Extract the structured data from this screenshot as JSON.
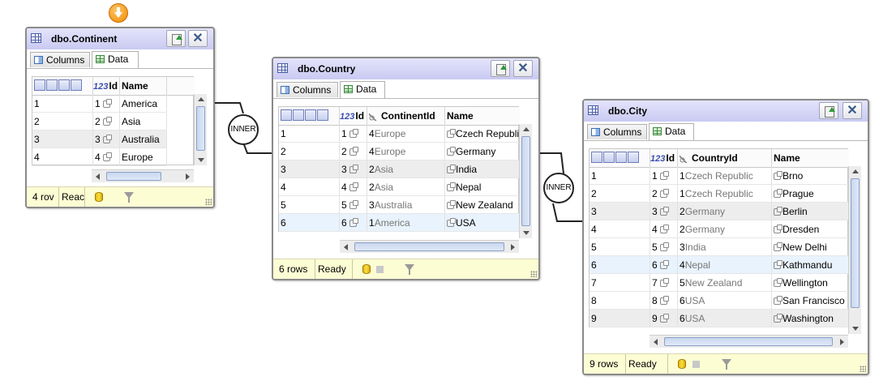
{
  "continent": {
    "title": "dbo.Continent",
    "tabs": [
      "Columns",
      "Data"
    ],
    "columns": [
      "Id",
      "Name"
    ],
    "rows": [
      {
        "num": "1",
        "id": "1",
        "name": "America"
      },
      {
        "num": "2",
        "id": "2",
        "name": "Asia"
      },
      {
        "num": "3",
        "id": "3",
        "name": "Australia"
      },
      {
        "num": "4",
        "id": "4",
        "name": "Europe"
      }
    ],
    "status": {
      "rows": "4 rov",
      "state": "Reac"
    }
  },
  "country": {
    "title": "dbo.Country",
    "tabs": [
      "Columns",
      "Data"
    ],
    "columns": [
      "Id",
      "ContinentId",
      "Name"
    ],
    "rows": [
      {
        "num": "1",
        "id": "1",
        "fk_id": "4",
        "fk_name": "Europe",
        "name": "Czech Republic"
      },
      {
        "num": "2",
        "id": "2",
        "fk_id": "4",
        "fk_name": "Europe",
        "name": "Germany"
      },
      {
        "num": "3",
        "id": "3",
        "fk_id": "2",
        "fk_name": "Asia",
        "name": "India"
      },
      {
        "num": "4",
        "id": "4",
        "fk_id": "2",
        "fk_name": "Asia",
        "name": "Nepal"
      },
      {
        "num": "5",
        "id": "5",
        "fk_id": "3",
        "fk_name": "Australia",
        "name": "New Zealand"
      },
      {
        "num": "6",
        "id": "6",
        "fk_id": "1",
        "fk_name": "America",
        "name": "USA"
      }
    ],
    "status": {
      "rows": "6 rows",
      "state": "Ready"
    }
  },
  "city": {
    "title": "dbo.City",
    "tabs": [
      "Columns",
      "Data"
    ],
    "columns": [
      "Id",
      "CountryId",
      "Name"
    ],
    "rows": [
      {
        "num": "1",
        "id": "1",
        "fk_id": "1",
        "fk_name": "Czech Republic",
        "name": "Brno"
      },
      {
        "num": "2",
        "id": "2",
        "fk_id": "1",
        "fk_name": "Czech Republic",
        "name": "Prague"
      },
      {
        "num": "3",
        "id": "3",
        "fk_id": "2",
        "fk_name": "Germany",
        "name": "Berlin"
      },
      {
        "num": "4",
        "id": "4",
        "fk_id": "2",
        "fk_name": "Germany",
        "name": "Dresden"
      },
      {
        "num": "5",
        "id": "5",
        "fk_id": "3",
        "fk_name": "India",
        "name": "New Delhi"
      },
      {
        "num": "6",
        "id": "6",
        "fk_id": "4",
        "fk_name": "Nepal",
        "name": "Kathmandu"
      },
      {
        "num": "7",
        "id": "7",
        "fk_id": "5",
        "fk_name": "New Zealand",
        "name": "Wellington"
      },
      {
        "num": "8",
        "id": "8",
        "fk_id": "6",
        "fk_name": "USA",
        "name": "San Francisco"
      },
      {
        "num": "9",
        "id": "9",
        "fk_id": "6",
        "fk_name": "USA",
        "name": "Washington"
      }
    ],
    "status": {
      "rows": "9 rows",
      "state": "Ready"
    }
  },
  "joins": [
    "INNER",
    "INNER"
  ],
  "icons": {
    "header_refresh": "refresh-icon",
    "header_close": "close-icon",
    "tab_columns": "columns-icon",
    "tab_data": "data-grid-icon",
    "status_db": "database-icon",
    "status_stop": "stop-icon",
    "status_filter": "filter-icon",
    "top_marker": "arrow-down-icon",
    "table": "table-icon",
    "key": "foreign-key-icon",
    "link": "link-icon"
  },
  "colors": {
    "header_gradient_top": "#e4e4fb",
    "header_gradient_bottom": "#c9caf2",
    "status_bar": "#fdfdd4",
    "selected_row": "#e9f3fd",
    "alt_row": "#ededed",
    "marker": "#f08a00"
  }
}
